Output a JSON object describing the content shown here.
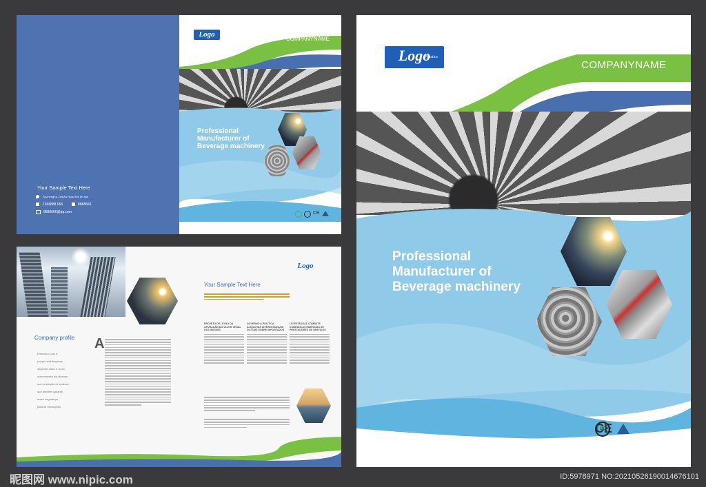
{
  "watermark": {
    "left": "昵图网 www.nipic.com",
    "right": "ID:5978971 NO:20210526190014676101"
  },
  "logo": {
    "text": "Logo",
    "sub": "Plastics"
  },
  "company_name": "COMPANYNAME",
  "headline": [
    "Professional",
    "Manufacturer of",
    "Beverage machinery"
  ],
  "back_cover": {
    "sample_text": "Your Sample Text Here",
    "contact": [
      {
        "icon": "location-icon",
        "text": "SuZhengXu XingXu Road Km 8n sas"
      },
      {
        "icon": "phone-icon",
        "text": "1368888 666"
      },
      {
        "icon": "fax-icon",
        "text": "8888666"
      },
      {
        "icon": "email-icon",
        "text": "8888666@qq.com"
      }
    ]
  },
  "inner": {
    "company_profile": "Company profile",
    "sample_heading": "Your Sample Text Here",
    "drop_cap": "A",
    "side_list": [
      "Entenda o que é,",
      "porque sua empresa",
      "depende disso e como",
      "a ferramenta iria diminuir",
      "com a adoção de sistema",
      "que também garante",
      "maior segurança",
      "para as transações"
    ],
    "col_heads": [
      "PROJETO DE LEI NO DA APURAÇÃO DO VALOR VENAL DOS IMÓVEIS",
      "GOVERNO A POLÍTICA ALIQUOTAS INTERESTADUAIS DO ICMS SOBRE IMPORTADOS",
      "LEI ESTADUAL COMBATE COBRANÇAS INDEVIDAS DE PRESTADORES DE SERVIÇOS"
    ]
  },
  "certs": [
    "ISO",
    "UL",
    "CE",
    "TÜV"
  ],
  "colors": {
    "blue": "#4a6fae",
    "green": "#7ac143",
    "light_blue": "#8ccbe8",
    "background": "#3a3a3c"
  }
}
